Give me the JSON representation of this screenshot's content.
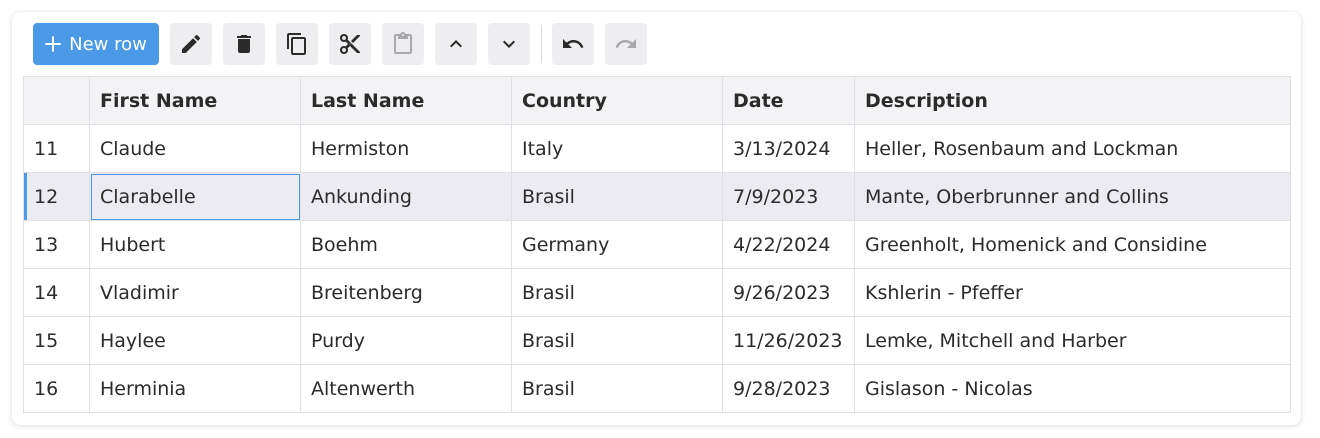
{
  "toolbar": {
    "new_row_label": "New row",
    "buttons": [
      "edit",
      "delete",
      "copy",
      "cut",
      "paste",
      "move-up",
      "move-down",
      "undo",
      "redo"
    ]
  },
  "grid": {
    "columns": [
      "",
      "First Name",
      "Last Name",
      "Country",
      "Date",
      "Description"
    ],
    "rows": [
      [
        "11",
        "Claude",
        "Hermiston",
        "Italy",
        "3/13/2024",
        "Heller, Rosenbaum and Lockman"
      ],
      [
        "12",
        "Clarabelle",
        "Ankunding",
        "Brasil",
        "7/9/2023",
        "Mante, Oberbrunner and Collins"
      ],
      [
        "13",
        "Hubert",
        "Boehm",
        "Germany",
        "4/22/2024",
        "Greenholt, Homenick and Considine"
      ],
      [
        "14",
        "Vladimir",
        "Breitenberg",
        "Brasil",
        "9/26/2023",
        "Kshlerin - Pfeffer"
      ],
      [
        "15",
        "Haylee",
        "Purdy",
        "Brasil",
        "11/26/2023",
        "Lemke, Mitchell and Harber"
      ],
      [
        "16",
        "Herminia",
        "Altenwerth",
        "Brasil",
        "9/28/2023",
        "Gislason - Nicolas"
      ]
    ],
    "selected_row": "12",
    "focused_cell": "Clarabelle"
  },
  "colors": {
    "accent": "#4a9ae8",
    "toolbar_button_bg": "#eeeef1",
    "header_bg": "#f3f3f6",
    "selected_row_bg": "#ebebf1"
  }
}
